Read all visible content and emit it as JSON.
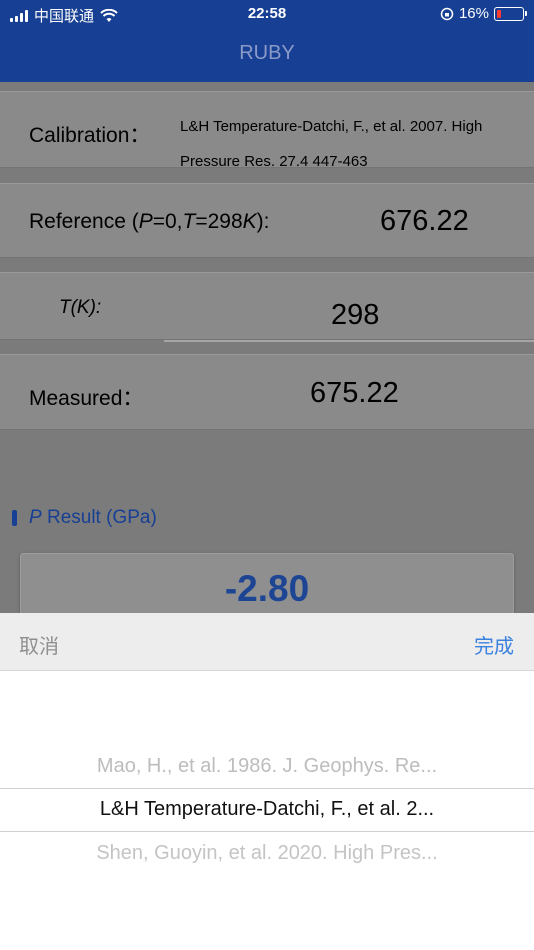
{
  "status_bar": {
    "carrier": "中国联通",
    "time": "22:58",
    "battery": "16%"
  },
  "nav": {
    "title": "RUBY"
  },
  "form": {
    "calibration_label": "Calibration：",
    "calibration_value": "L&H Temperature-Datchi, F., et al. 2007. High Pressure Res. 27.4 447-463",
    "reference_label_a": "Reference (",
    "reference_label_p": "P",
    "reference_label_b": "=0,",
    "reference_label_t": "T",
    "reference_label_c": "=298",
    "reference_label_k": "K",
    "reference_label_d": "):",
    "reference_value": "676.22",
    "temperature_label": "T(K):",
    "temperature_value": "298",
    "measured_label": "Measured：",
    "measured_value": "675.22"
  },
  "result": {
    "p": "P",
    "label": "Result (GPa)",
    "value": "-2.80"
  },
  "picker_toolbar": {
    "cancel": "取消",
    "done": "完成"
  },
  "picker_options": [
    "Mao, H., et al. 1986. J. Geophys. Re...",
    "L&H Temperature-Datchi, F., et al. 2...",
    "Shen, Guoyin, et al. 2020. High Pres..."
  ],
  "colors": {
    "nav": "#173f93",
    "accent": "#3b82e0",
    "result": "#1d4593"
  }
}
